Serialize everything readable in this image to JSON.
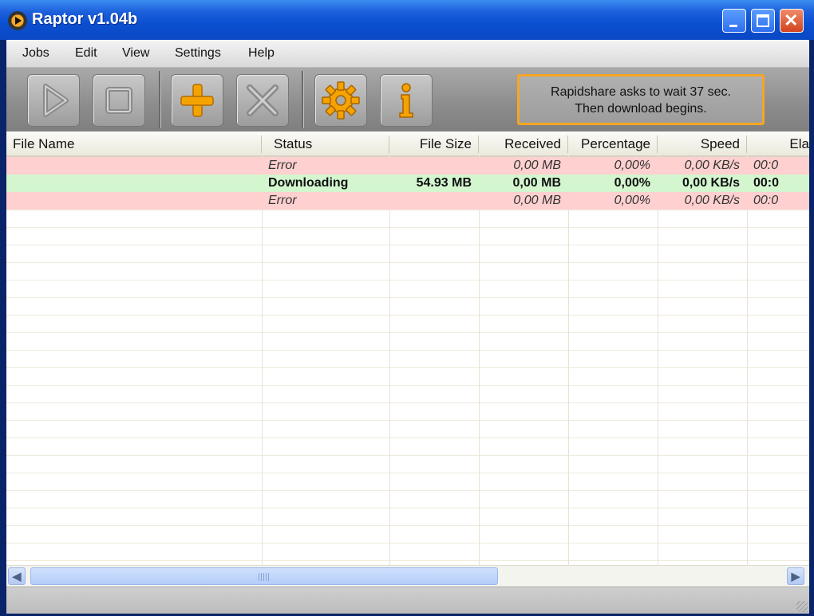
{
  "window": {
    "title": "Raptor v1.04b"
  },
  "menu": [
    "Jobs",
    "Edit",
    "View",
    "Settings",
    "Help"
  ],
  "toolbar": {
    "icons": [
      "play-icon",
      "stop-icon",
      "add-icon",
      "remove-icon",
      "settings-gear-icon",
      "info-icon"
    ],
    "notice_line1": "Rapidshare asks to wait 37 sec.",
    "notice_line2": "Then download begins."
  },
  "list": {
    "columns": [
      "File Name",
      "Status",
      "File Size",
      "Received",
      "Percentage",
      "Speed",
      "Ela"
    ],
    "rows": [
      {
        "file_name": "",
        "status": "Error",
        "file_size": "",
        "received": "0,00 MB",
        "percentage": "0,00%",
        "speed": "0,00 KB/s",
        "elapsed": "00:0",
        "state": "error"
      },
      {
        "file_name": "",
        "status": "Downloading",
        "file_size": "54.93 MB",
        "received": "0,00 MB",
        "percentage": "0,00%",
        "speed": "0,00 KB/s",
        "elapsed": "00:0",
        "state": "downloading"
      },
      {
        "file_name": "",
        "status": "Error",
        "file_size": "",
        "received": "0,00 MB",
        "percentage": "0,00%",
        "speed": "0,00 KB/s",
        "elapsed": "00:0",
        "state": "error"
      }
    ]
  },
  "colors": {
    "error_row": "#ffd0d0",
    "downloading_row": "#d3f6cf",
    "accent": "#f5a623",
    "titlebar": "#0a4fd0"
  }
}
